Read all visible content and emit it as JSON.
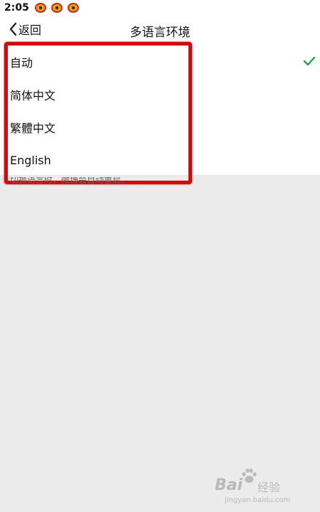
{
  "status_bar": {
    "time": "2:05",
    "notification_icons": [
      "weibo-icon",
      "weibo-icon",
      "weibo-icon"
    ]
  },
  "header": {
    "back_label": "返回",
    "back_icon": "chevron-left-icon",
    "title": "多语言环境"
  },
  "languages": [
    {
      "label": "自动",
      "selected": true
    },
    {
      "label": "简体中文",
      "selected": false
    },
    {
      "label": "繁體中文",
      "selected": false
    },
    {
      "label": "English",
      "selected": false
    }
  ],
  "hint": "切换语言时，微博会自动重启。",
  "watermark": {
    "brand": "Bai",
    "paw_icon": "baidu-paw-icon",
    "name": "经验",
    "url": "jingyan.baidu.com"
  },
  "colors": {
    "check": "#1aa34a",
    "highlight": "#d10a0a",
    "background": "#ebebeb"
  }
}
